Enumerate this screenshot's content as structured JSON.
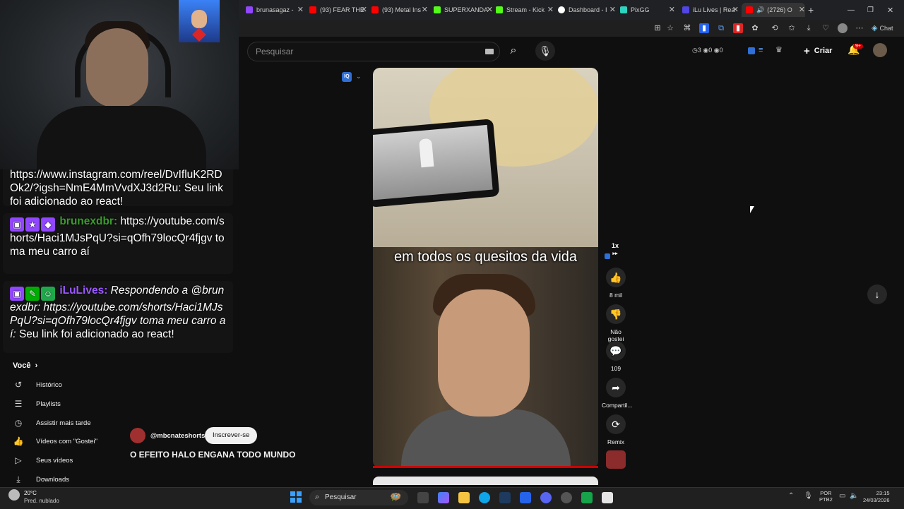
{
  "browser": {
    "tabs": [
      {
        "label": "brunasagaz -",
        "color": "#9146ff"
      },
      {
        "label": "(93) FEAR THE",
        "color": "#ff0000"
      },
      {
        "label": "(93) Metal Ins",
        "color": "#ff0000"
      },
      {
        "label": "SUPERXANDA",
        "color": "#53fc18"
      },
      {
        "label": "Stream - Kick",
        "color": "#53fc18"
      },
      {
        "label": "Dashboard - I",
        "color": "#ffffff"
      },
      {
        "label": "PixGG",
        "color": "#2dd4bf"
      },
      {
        "label": "iLu Lives | Rea",
        "color": "#4f46e5"
      },
      {
        "label": "(2726) O",
        "color": "#ff0000"
      }
    ],
    "chat_button": "Chat"
  },
  "youtube": {
    "search_placeholder": "Pesquisar",
    "stats": "◷3 ◉0 ◉0",
    "create_label": "Criar",
    "notif_badge": "9+",
    "iq_chip": "IQ"
  },
  "chat": {
    "messages": [
      {
        "user": "",
        "text": "https://www.instagram.com/reel/DvIfluK2RDOk2/?igsh=NmE4MmVvdXJ3d2Ru:",
        "suffix": "Seu link foi adicionado ao react!"
      },
      {
        "user": "brunexdbr:",
        "text": "https://youtube.com/shorts/Haci1MJsPqU?si=qOfh79locQr4fjgv toma meu carro aí",
        "suffix": ""
      },
      {
        "user": "iLuLives:",
        "text": "Respondendo a @brunexdbr: https://youtube.com/shorts/Haci1MJsPqU?si=qOfh79locQr4fjgv toma meu carro aí:",
        "suffix": "Seu link foi adicionado ao react!"
      }
    ]
  },
  "sidebar": {
    "section": "Você",
    "items": [
      {
        "label": "Histórico",
        "icon": "history-icon"
      },
      {
        "label": "Playlists",
        "icon": "playlists-icon"
      },
      {
        "label": "Assistir mais tarde",
        "icon": "clock-icon"
      },
      {
        "label": "Vídeos com \"Gostei\"",
        "icon": "thumb-up-icon"
      },
      {
        "label": "Seus vídeos",
        "icon": "play-icon"
      },
      {
        "label": "Downloads",
        "icon": "download-icon"
      }
    ]
  },
  "short": {
    "caption": "em todos os quesitos da vida",
    "channel": "@mbcnateshorts",
    "subscribe_label": "Inscrever-se",
    "title": "O EFEITO HALO ENGANA TODO MUNDO",
    "speed": "1x",
    "like_count": "8 mil",
    "dislike_label": "Não gostei",
    "comments_count": "109",
    "share_label": "Compartil...",
    "remix_label": "Remix"
  },
  "taskbar": {
    "temp": "20°C",
    "weather": "Pred. nublado",
    "search_label": "Pesquisar",
    "lang": "POR",
    "layout": "PTB2",
    "time": "23:15",
    "date": "24/03/2026"
  }
}
